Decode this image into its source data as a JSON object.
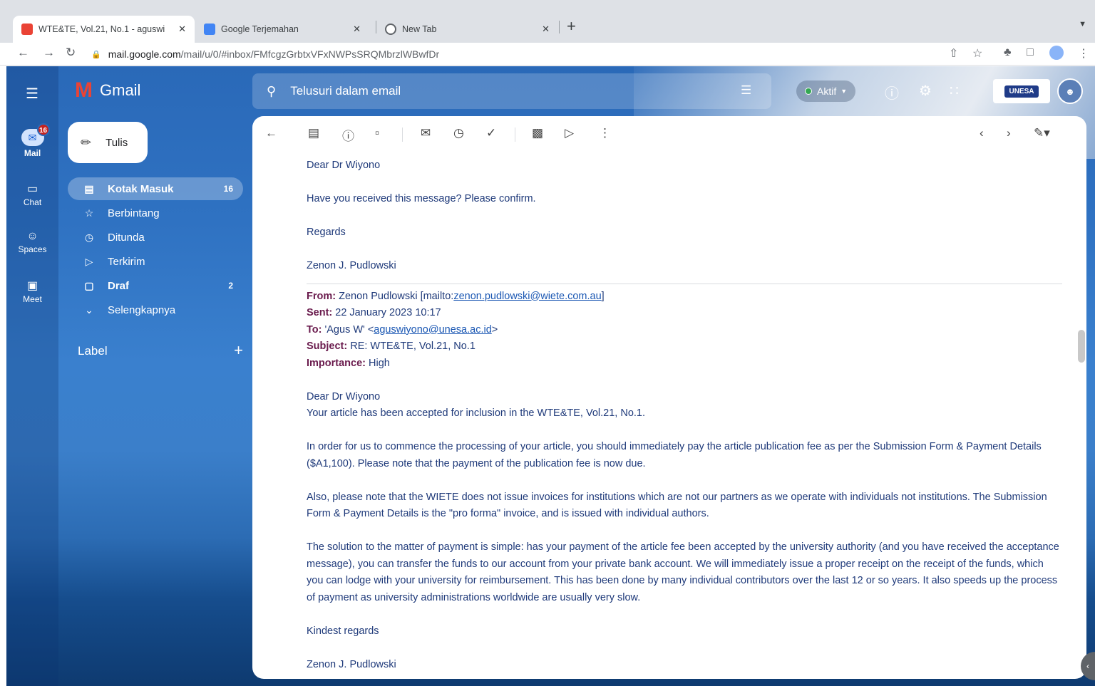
{
  "browser": {
    "tabs": [
      {
        "title": "WTE&TE, Vol.21, No.1 - aguswi",
        "close": "✕",
        "favicon_color": "#ea4335"
      },
      {
        "title": "Google Terjemahan",
        "close": "✕",
        "favicon_color": "#4285f4"
      },
      {
        "title": "New Tab",
        "close": "✕",
        "favicon_color": "#5f6368"
      }
    ],
    "new_tab": "+",
    "url_host": "mail.google.com",
    "url_path": "/mail/u/0/#inbox/FMfcgzGrbtxVFxNWPsSRQMbrzlWBwfDr"
  },
  "gmail": {
    "app_name": "Gmail",
    "rail": [
      {
        "label": "Mail",
        "badge": "16"
      },
      {
        "label": "Chat"
      },
      {
        "label": "Spaces"
      },
      {
        "label": "Meet"
      }
    ],
    "compose_label": "Tulis",
    "folders": [
      {
        "label": "Kotak Masuk",
        "count": "16"
      },
      {
        "label": "Berbintang",
        "count": ""
      },
      {
        "label": "Ditunda",
        "count": ""
      },
      {
        "label": "Terkirim",
        "count": ""
      },
      {
        "label": "Draf",
        "count": "2"
      },
      {
        "label": "Selengkapnya",
        "count": ""
      }
    ],
    "label_heading": "Label",
    "label_add": "+",
    "search_placeholder": "Telusuri dalam email",
    "status": "Aktif",
    "org_logo_text": "UNESA"
  },
  "message": {
    "salutation1": "Dear Dr Wiyono",
    "line1": "Have you received this message? Please confirm.",
    "regards1": "Regards",
    "sig1": "Zenon J. Pudlowski",
    "from_key": "From:",
    "from_name": " Zenon Pudlowski [mailto:",
    "from_email": "zenon.pudlowski@wiete.com.au",
    "from_end": "]",
    "sent_key": "Sent:",
    "sent_val": " 22 January 2023 10:17",
    "to_key": "To:",
    "to_name": " 'Agus W' <",
    "to_email": "aguswiyono@unesa.ac.id",
    "to_end": ">",
    "subject_key": "Subject:",
    "subject_val": " RE: WTE&TE, Vol.21, No.1",
    "importance_key": "Importance:",
    "importance_val": " High",
    "salutation2": "Dear Dr Wiyono",
    "accept_line": "Your article has been accepted for inclusion in the WTE&TE, Vol.21, No.1.",
    "para1": "In order for us to commence the processing of your article, you should immediately pay the article publication fee as per the Submission Form & Payment Details ($A1,100). Please note that the payment of the publication fee is now due.",
    "para2": "Also, please note that the WIETE does not issue invoices for institutions which are not our partners as we operate with individuals not institutions. The Submission Form & Payment Details is the \"pro forma\" invoice, and is issued with individual authors.",
    "para3": "The solution to the matter of payment is simple: has your payment of the article fee been accepted by the university authority (and you have received the acceptance message), you can transfer the funds to our account from your private bank account. We will immediately issue a proper receipt on the receipt of the funds, which you can lodge with your university for reimbursement. This has been done by many individual contributors over the last 12 or so years. It also speeds up the process of payment as university administrations worldwide are usually very slow.",
    "regards2": "Kindest regards",
    "sig2": "Zenon J. Pudlowski"
  }
}
